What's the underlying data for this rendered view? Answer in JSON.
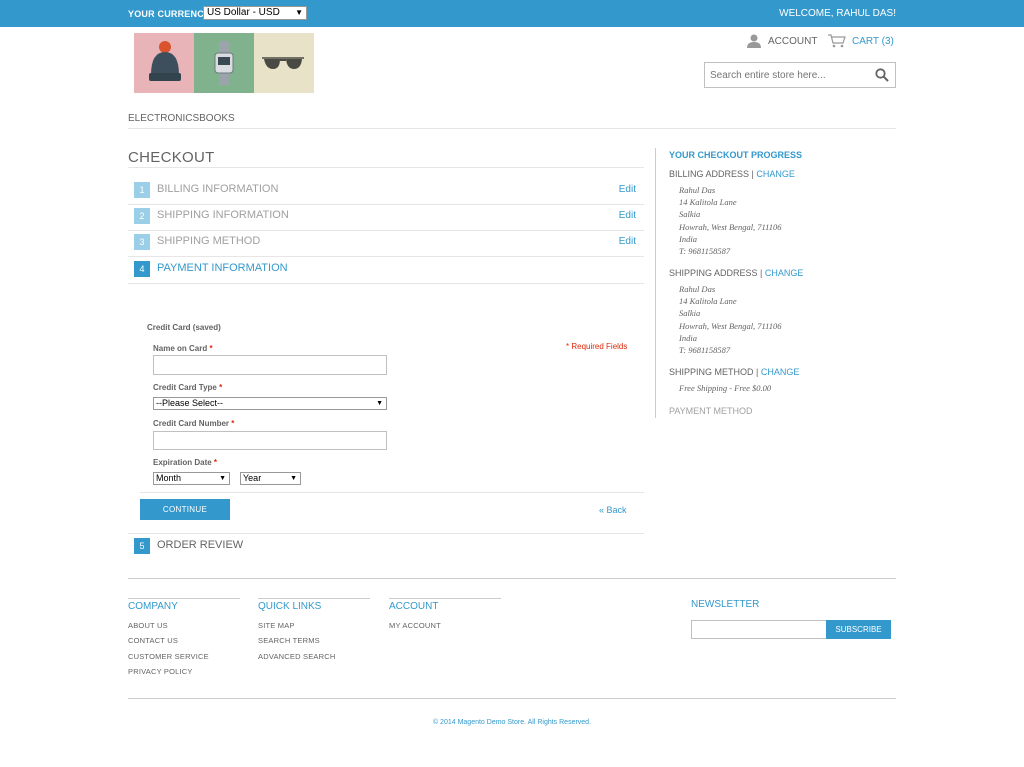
{
  "topbar": {
    "currency_label": "YOUR CURRENCY:",
    "currency_value": "US Dollar - USD",
    "welcome": "WELCOME, RAHUL DAS!"
  },
  "header": {
    "account_label": "ACCOUNT",
    "cart_label": "CART (3)",
    "search_placeholder": "Search entire store here..."
  },
  "nav": {
    "label": "ELECTRONICSBOOKS"
  },
  "checkout": {
    "title": "CHECKOUT",
    "steps": [
      {
        "num": "1",
        "label": "BILLING INFORMATION",
        "edit": "Edit"
      },
      {
        "num": "2",
        "label": "SHIPPING INFORMATION",
        "edit": "Edit"
      },
      {
        "num": "3",
        "label": "SHIPPING METHOD",
        "edit": "Edit"
      },
      {
        "num": "4",
        "label": "PAYMENT INFORMATION"
      },
      {
        "num": "5",
        "label": "ORDER REVIEW"
      }
    ],
    "payment": {
      "method_label": "Credit Card (saved)",
      "required_note": "* Required Fields",
      "name_label": "Name on Card",
      "type_label": "Credit Card Type",
      "type_value": "--Please Select--",
      "number_label": "Credit Card Number",
      "exp_label": "Expiration Date",
      "month_value": "Month",
      "year_value": "Year",
      "continue": "CONTINUE",
      "back": "« Back"
    }
  },
  "progress": {
    "title": "YOUR CHECKOUT PROGRESS",
    "billing_heading": "BILLING ADDRESS",
    "shipping_heading": "SHIPPING ADDRESS",
    "method_heading": "SHIPPING METHOD",
    "change": "CHANGE",
    "sep": "|",
    "billing_lines": [
      "Rahul Das",
      "14 Kalitola Lane",
      "Salkia",
      "Howrah, West Bengal, 711106",
      "India",
      "T: 9681158587"
    ],
    "shipping_lines": [
      "Rahul Das",
      "14 Kalitola Lane",
      "Salkia",
      "Howrah, West Bengal, 711106",
      "India",
      "T: 9681158587"
    ],
    "method_value": "Free Shipping - Free $0.00",
    "payment_heading": "PAYMENT METHOD"
  },
  "footer": {
    "company": {
      "title": "COMPANY",
      "links": [
        "ABOUT US",
        "CONTACT US",
        "CUSTOMER SERVICE",
        "PRIVACY POLICY"
      ]
    },
    "quick": {
      "title": "QUICK LINKS",
      "links": [
        "SITE MAP",
        "SEARCH TERMS",
        "ADVANCED SEARCH"
      ]
    },
    "account": {
      "title": "ACCOUNT",
      "links": [
        "MY ACCOUNT"
      ]
    },
    "newsletter": {
      "title": "NEWSLETTER",
      "button": "SUBSCRIBE"
    },
    "copyright": "© 2014 Magento Demo Store. All Rights Reserved."
  },
  "colors": {
    "accent": "#3399cc",
    "step_inactive": "#9bcfe8",
    "required": "#df280a"
  }
}
